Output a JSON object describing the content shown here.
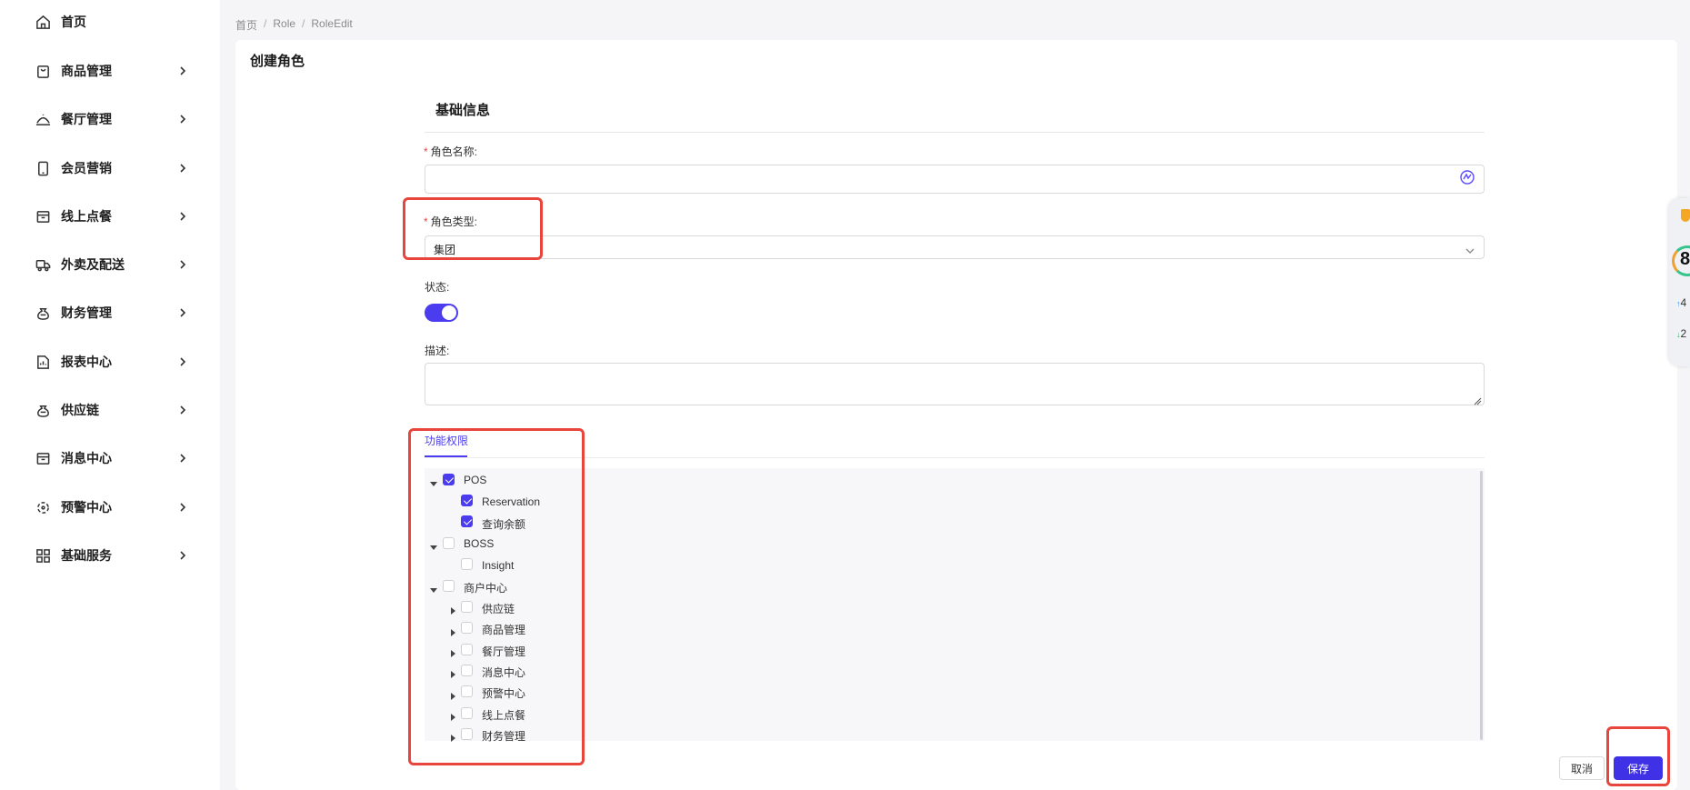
{
  "sidebar": {
    "items": [
      {
        "label": "首页",
        "has_children": false
      },
      {
        "label": "商品管理",
        "has_children": true
      },
      {
        "label": "餐厅管理",
        "has_children": true
      },
      {
        "label": "会员营销",
        "has_children": true
      },
      {
        "label": "线上点餐",
        "has_children": true
      },
      {
        "label": "外卖及配送",
        "has_children": true
      },
      {
        "label": "财务管理",
        "has_children": true
      },
      {
        "label": "报表中心",
        "has_children": true
      },
      {
        "label": "供应链",
        "has_children": true
      },
      {
        "label": "消息中心",
        "has_children": true
      },
      {
        "label": "预警中心",
        "has_children": true
      },
      {
        "label": "基础服务",
        "has_children": true
      }
    ]
  },
  "breadcrumb": [
    "首页",
    "Role",
    "RoleEdit"
  ],
  "page": {
    "title": "创建角色",
    "section_title": "基础信息"
  },
  "form": {
    "role_name": {
      "label": "角色名称:",
      "value": "",
      "required": true
    },
    "role_type": {
      "label": "角色类型:",
      "value": "集团",
      "required": true
    },
    "status": {
      "label": "状态:",
      "enabled": true
    },
    "description": {
      "label": "描述:",
      "value": ""
    }
  },
  "permissions": {
    "tab_label": "功能权限",
    "tree": [
      {
        "label": "POS",
        "checked": true,
        "expanded": true,
        "children": [
          {
            "label": "Reservation",
            "checked": true
          },
          {
            "label": "查询余额",
            "checked": true
          }
        ]
      },
      {
        "label": "BOSS",
        "checked": false,
        "expanded": true,
        "children": [
          {
            "label": "Insight",
            "checked": false
          }
        ]
      },
      {
        "label": "商户中心",
        "checked": false,
        "expanded": true,
        "children": [
          {
            "label": "供应链",
            "checked": false,
            "expandable": true
          },
          {
            "label": "商品管理",
            "checked": false,
            "expandable": true
          },
          {
            "label": "餐厅管理",
            "checked": false,
            "expandable": true
          },
          {
            "label": "消息中心",
            "checked": false,
            "expandable": true
          },
          {
            "label": "预警中心",
            "checked": false,
            "expandable": true
          },
          {
            "label": "线上点餐",
            "checked": false,
            "expandable": true
          },
          {
            "label": "财务管理",
            "checked": false,
            "expandable": true
          }
        ]
      }
    ]
  },
  "actions": {
    "cancel_label": "取消",
    "save_label": "保存"
  },
  "side_widget": {
    "score": "8",
    "stat_up": "4",
    "stat_down": "2"
  },
  "colors": {
    "primary": "#4b3cf0",
    "highlight": "#e8453c",
    "required": "#e5484d"
  }
}
